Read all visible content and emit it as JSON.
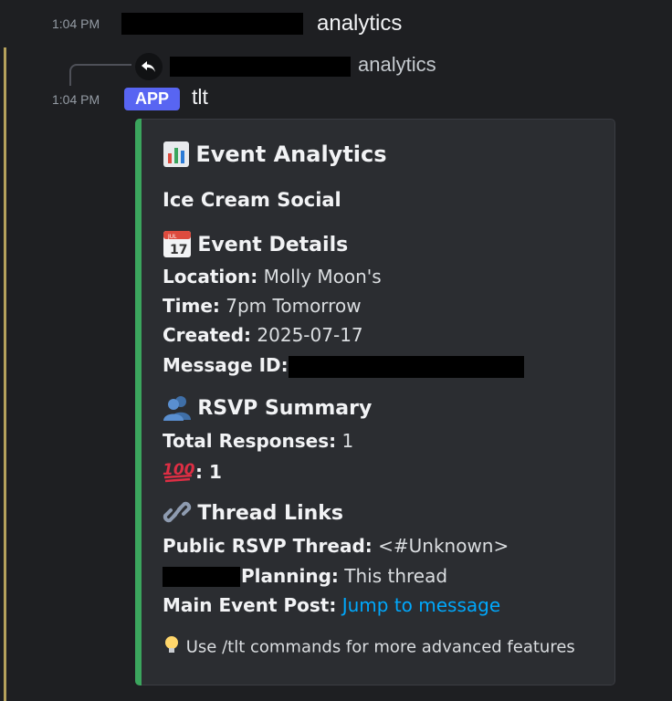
{
  "header": {
    "time": "1:04 PM",
    "channel_suffix": "analytics"
  },
  "reply": {
    "text": "analytics"
  },
  "message": {
    "time": "1:04 PM",
    "badge": "APP",
    "author": "tlt"
  },
  "embed": {
    "accent_color": "#3ba55d",
    "title_icon": "bar-chart-icon",
    "title": "Event Analytics",
    "event_name": "Ice Cream Social",
    "details": {
      "heading_icon": "calendar-icon",
      "heading": "Event Details",
      "location_label": "Location:",
      "location_value": "Molly Moon's",
      "time_label": "Time:",
      "time_value": "7pm Tomorrow",
      "created_label": "Created:",
      "created_value": "2025-07-17",
      "message_id_label": "Message ID:"
    },
    "rsvp": {
      "heading_icon": "people-icon",
      "heading": "RSVP Summary",
      "total_label": "Total Responses:",
      "total_value": "1",
      "hundred_icon": "hundred-points-icon",
      "hundred_value": ": 1"
    },
    "threads": {
      "heading_icon": "link-icon",
      "heading": "Thread Links",
      "public_label": "Public RSVP Thread:",
      "public_value": "<#Unknown>",
      "planning_label": "Planning:",
      "planning_value": "This thread",
      "main_label": "Main Event Post:",
      "main_link": "Jump to message"
    },
    "footer_icon": "lightbulb-icon",
    "footer": "Use /tlt commands for more advanced features"
  }
}
